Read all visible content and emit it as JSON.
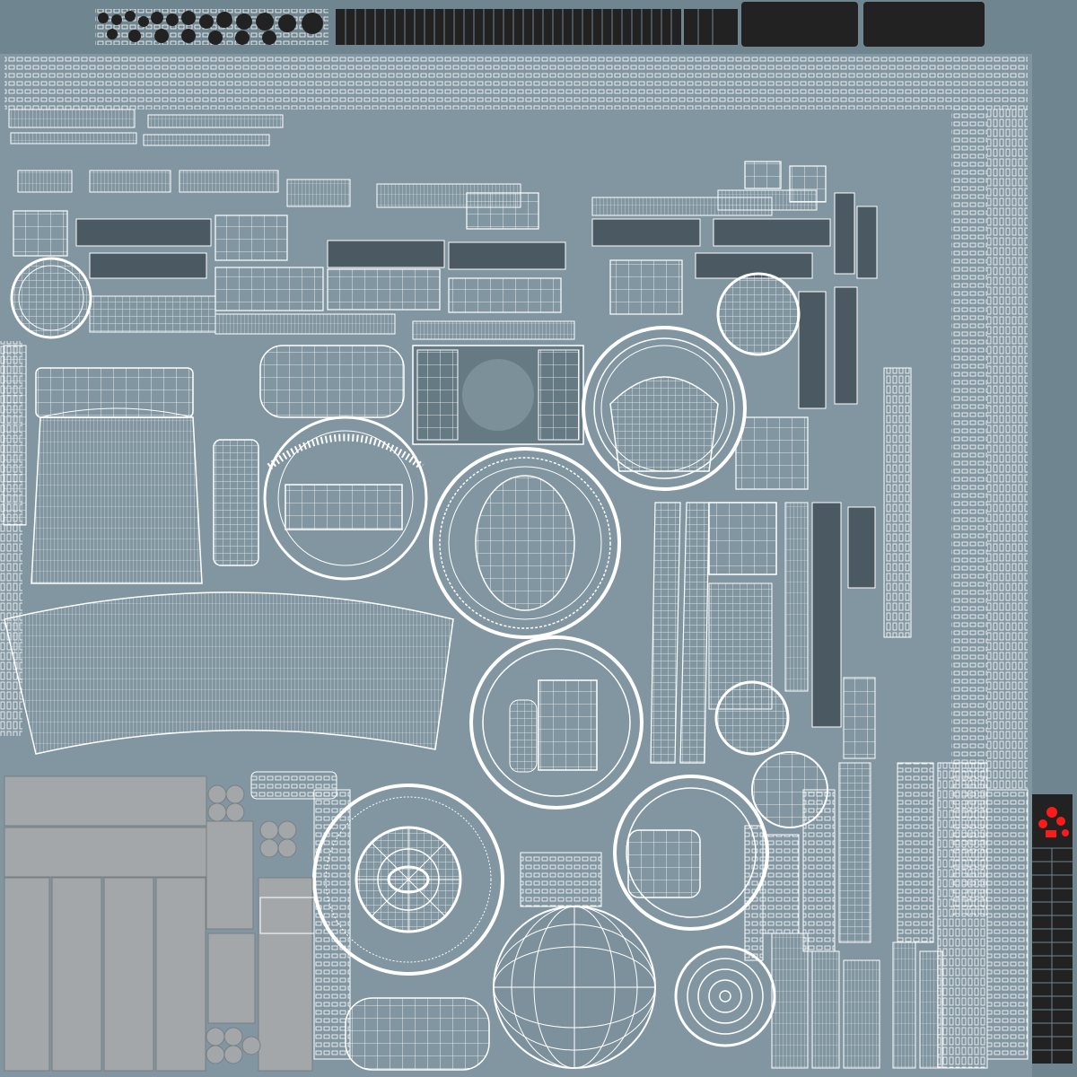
{
  "colors": {
    "background": "#6f8590",
    "island_fill": "#8196a1",
    "island_dark": "#4b5a62",
    "wire": "#ffffff",
    "grey_block": "#a3a7aa",
    "black_block": "#222222",
    "accent_red": "#ff1a1a"
  }
}
